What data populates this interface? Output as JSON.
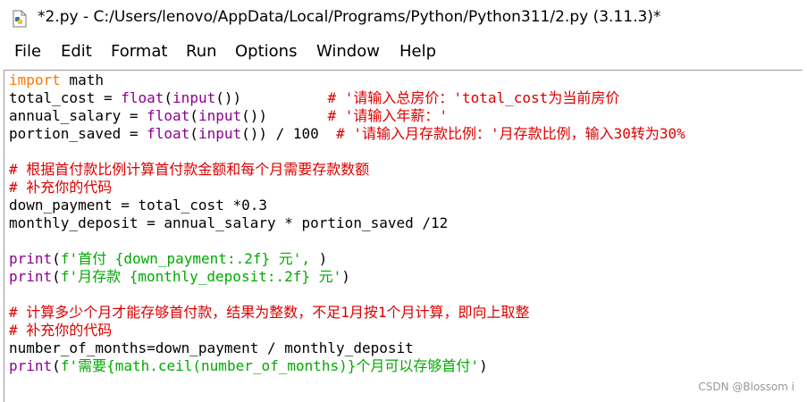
{
  "window": {
    "title": "*2.py - C:/Users/lenovo/AppData/Local/Programs/Python/Python311/2.py (3.11.3)*",
    "icon": "python-file-icon"
  },
  "menu": [
    "File",
    "Edit",
    "Format",
    "Run",
    "Options",
    "Window",
    "Help"
  ],
  "code": [
    [
      {
        "t": "import",
        "c": "kw"
      },
      {
        "t": " math",
        "c": "df"
      }
    ],
    [
      {
        "t": "total_cost = ",
        "c": "df"
      },
      {
        "t": "float",
        "c": "bi"
      },
      {
        "t": "(",
        "c": "df"
      },
      {
        "t": "input",
        "c": "bi"
      },
      {
        "t": "())          ",
        "c": "df"
      },
      {
        "t": "# '请输入总房价：'total_cost为当前房价",
        "c": "cm"
      }
    ],
    [
      {
        "t": "annual_salary = ",
        "c": "df"
      },
      {
        "t": "float",
        "c": "bi"
      },
      {
        "t": "(",
        "c": "df"
      },
      {
        "t": "input",
        "c": "bi"
      },
      {
        "t": "())       ",
        "c": "df"
      },
      {
        "t": "# '请输入年薪：'",
        "c": "cm"
      }
    ],
    [
      {
        "t": "portion_saved = ",
        "c": "df"
      },
      {
        "t": "float",
        "c": "bi"
      },
      {
        "t": "(",
        "c": "df"
      },
      {
        "t": "input",
        "c": "bi"
      },
      {
        "t": "()) / 100  ",
        "c": "df"
      },
      {
        "t": "# '请输入月存款比例：'月存款比例，输入30转为30%",
        "c": "cm"
      }
    ],
    [],
    [
      {
        "t": "# 根据首付款比例计算首付款金额和每个月需要存款数额",
        "c": "cm"
      }
    ],
    [
      {
        "t": "# 补充你的代码",
        "c": "cm"
      }
    ],
    [
      {
        "t": "down_payment = total_cost *0.3",
        "c": "df"
      }
    ],
    [
      {
        "t": "monthly_deposit = annual_salary * portion_saved /12",
        "c": "df"
      }
    ],
    [],
    [
      {
        "t": "print",
        "c": "bi"
      },
      {
        "t": "(",
        "c": "df"
      },
      {
        "t": "f'首付 {down_payment:.2f} 元', ",
        "c": "st"
      },
      {
        "t": ")",
        "c": "df"
      }
    ],
    [
      {
        "t": "print",
        "c": "bi"
      },
      {
        "t": "(",
        "c": "df"
      },
      {
        "t": "f'月存款 {monthly_deposit:.2f} 元'",
        "c": "st"
      },
      {
        "t": ")",
        "c": "df"
      }
    ],
    [],
    [
      {
        "t": "# 计算多少个月才能存够首付款，结果为整数，不足1月按1个月计算，即向上取整",
        "c": "cm"
      }
    ],
    [
      {
        "t": "# 补充你的代码",
        "c": "cm"
      }
    ],
    [
      {
        "t": "number_of_months=down_payment / monthly_deposit",
        "c": "df"
      }
    ],
    [
      {
        "t": "print",
        "c": "bi"
      },
      {
        "t": "(",
        "c": "df"
      },
      {
        "t": "f'需要{math.ceil(number_of_months)}个月可以存够首付'",
        "c": "st"
      },
      {
        "t": ")",
        "c": "df"
      }
    ]
  ],
  "watermark": "CSDN @Blossom i",
  "colors": {
    "keyword": "#ff7700",
    "builtin": "#900090",
    "comment": "#dd0000",
    "string": "#00aa00",
    "default": "#000000"
  }
}
